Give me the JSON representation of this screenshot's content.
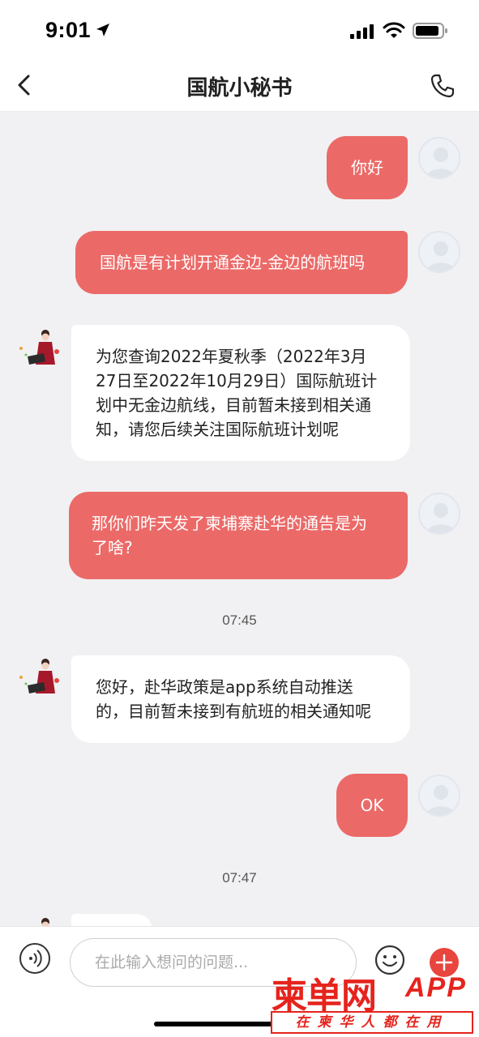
{
  "status_bar": {
    "time": "9:01"
  },
  "header": {
    "title": "国航小秘书"
  },
  "messages": {
    "m1": "你好",
    "m2": "国航是有计划开通金边-金边的航班吗",
    "m3_lines": [
      "为您查询2022年夏秋季（2022年3月",
      "27日至2022年10月29日）国际航班计",
      "划中无金边航线，目前暂未接到相关通",
      "知，请您后续关注国际航班计划呢"
    ],
    "m4_lines": [
      "那你们昨天发了柬埔寨赴华的通告是为",
      "了啥?"
    ],
    "time1": "07:45",
    "m5_lines": [
      "您好，赴华政策是app系统自动推送",
      "的，目前暂未接到有航班的相关通知呢"
    ],
    "m6": "OK",
    "time2": "07:47"
  },
  "input": {
    "placeholder": "在此输入想问的问题..."
  },
  "watermark": {
    "main": "柬单网",
    "app": "APP",
    "sub": "在柬华人都在用"
  },
  "colors": {
    "user_bubble": "#eb6a68",
    "accent": "#e5241d",
    "background": "#f1f1f3"
  }
}
